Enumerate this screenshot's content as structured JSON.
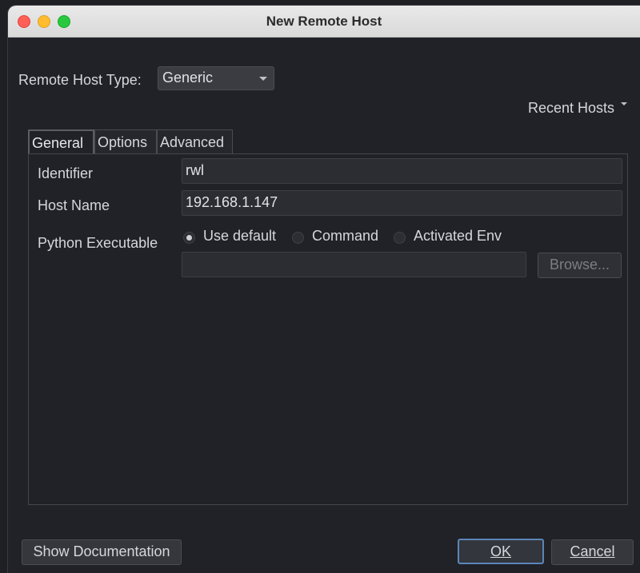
{
  "window": {
    "title": "New Remote Host"
  },
  "remote_host_type": {
    "label": "Remote Host Type:",
    "selected": "Generic"
  },
  "recent_hosts": {
    "label": "Recent Hosts"
  },
  "tabs": [
    {
      "label": "General",
      "active": true
    },
    {
      "label": "Options",
      "active": false
    },
    {
      "label": "Advanced",
      "active": false
    }
  ],
  "general": {
    "identifier": {
      "label": "Identifier",
      "value": "rwl"
    },
    "host_name": {
      "label": "Host Name",
      "value": "192.168.1.147"
    },
    "python_executable": {
      "label": "Python Executable",
      "options": [
        {
          "label": "Use default",
          "checked": true
        },
        {
          "label": "Command",
          "checked": false
        },
        {
          "label": "Activated Env",
          "checked": false
        }
      ],
      "path_value": "",
      "browse_label": "Browse..."
    }
  },
  "footer": {
    "show_documentation_label": "Show Documentation",
    "ok_label": "OK",
    "cancel_label": "Cancel"
  },
  "colors": {
    "background": "#202227",
    "default_button_border": "#5b85b8"
  }
}
